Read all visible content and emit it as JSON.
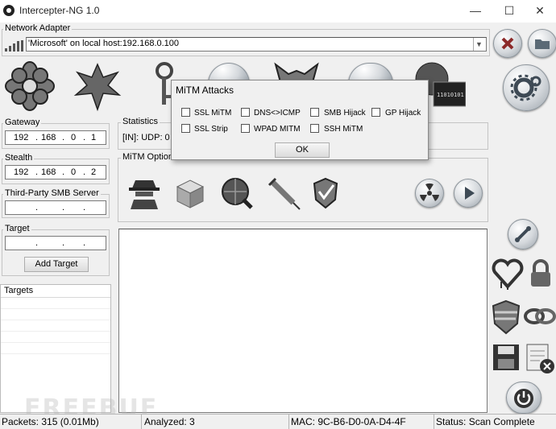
{
  "window": {
    "title": "Intercepter-NG 1.0",
    "minimize": "—",
    "maximize": "☐",
    "close": "✕"
  },
  "network_adapter": {
    "label": "Network Adapter",
    "value": "'Microsoft' on local host:192.168.0.100"
  },
  "gateway": {
    "label": "Gateway",
    "octets": [
      "192",
      "168",
      "0",
      "1"
    ]
  },
  "stealth": {
    "label": "Stealth",
    "octets": [
      "192",
      "168",
      "0",
      "2"
    ]
  },
  "third_party_smb": {
    "label": "Third-Party SMB Server",
    "octets": [
      "",
      "",
      "",
      ""
    ]
  },
  "target": {
    "label": "Target",
    "octets": [
      "",
      "",
      "",
      ""
    ],
    "add_button": "Add Target"
  },
  "targets_list": {
    "label": "Targets"
  },
  "statistics": {
    "label": "Statistics",
    "text": "[IN]: UDP: 0 T"
  },
  "mitm_options": {
    "label": "MiTM Options"
  },
  "dialog": {
    "title": "MiTM Attacks",
    "options_row1": [
      "SSL MiTM",
      "DNS<>ICMP",
      "SMB Hijack",
      "GP Hijack"
    ],
    "options_row2": [
      "SSL Strip",
      "WPAD MITM",
      "SSH MiTM"
    ],
    "ok": "OK"
  },
  "statusbar": {
    "packets": "Packets: 315 (0.01Mb)",
    "analyzed": "Analyzed: 3",
    "mac": "MAC: 9C-B6-D0-0A-D4-4F",
    "status": "Status: Scan Complete"
  },
  "watermark": "FREEBUF",
  "colors": {
    "accent": "#1e6fb8",
    "danger": "#c0392b"
  }
}
